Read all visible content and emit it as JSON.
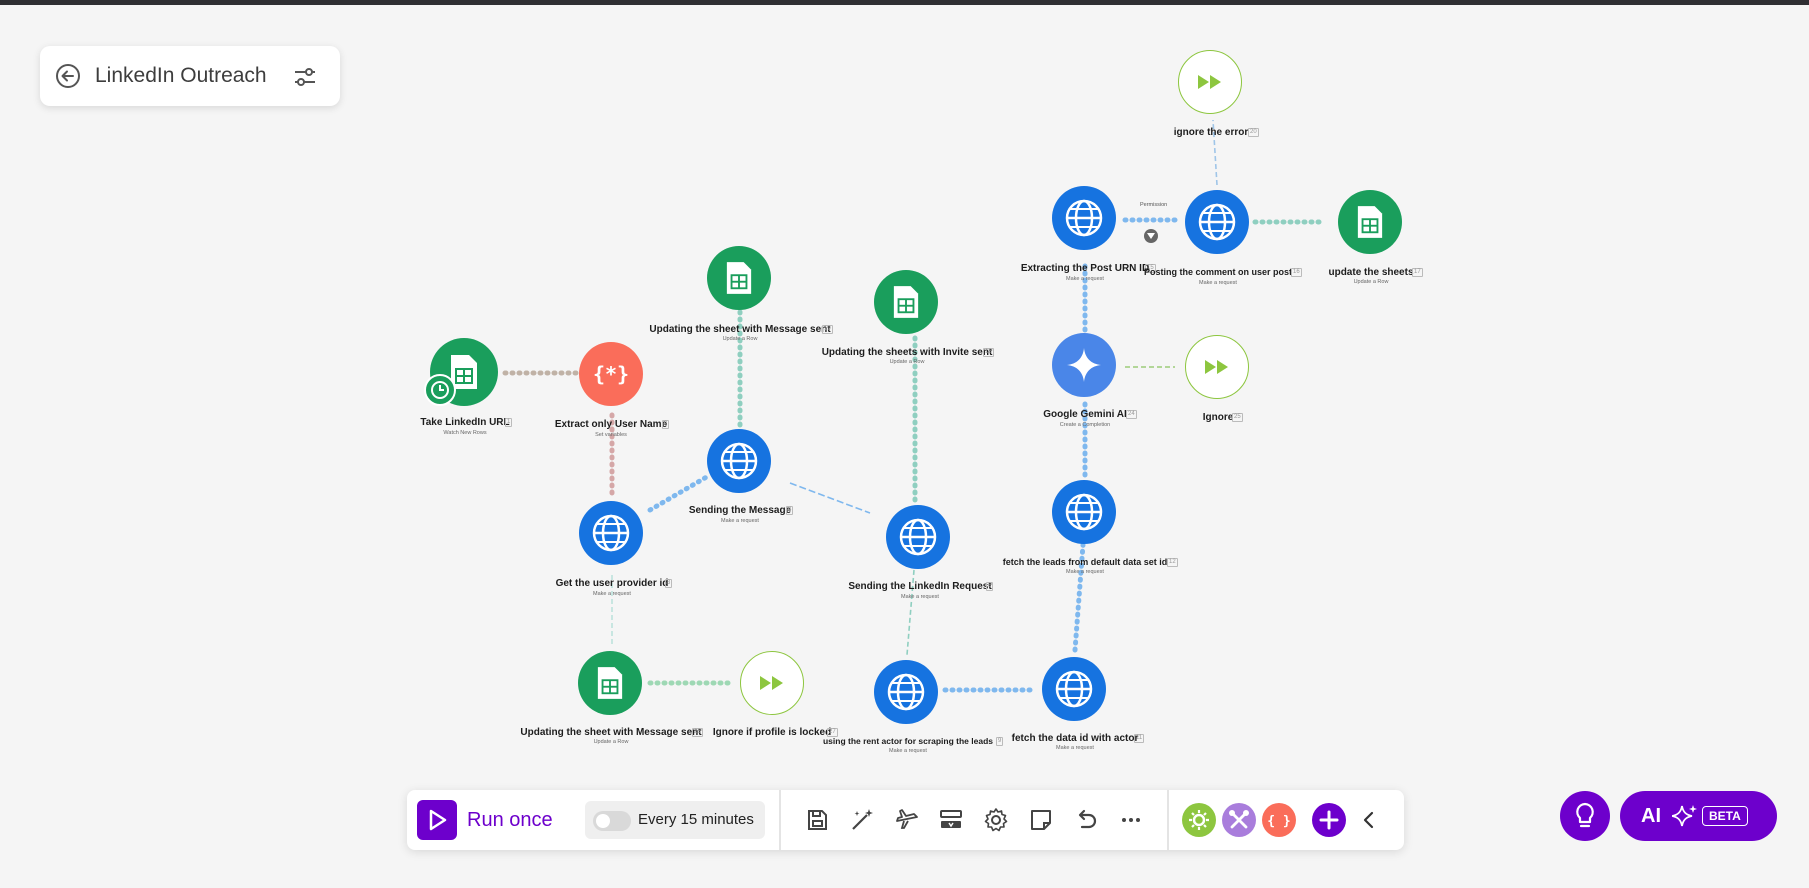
{
  "scenario": {
    "title": "LinkedIn Outreach",
    "back_icon": "arrow-left-circle-icon",
    "settings_icon": "sliders-icon"
  },
  "colors": {
    "sheets": "#1a9e5c",
    "tools": "#fa6d5a",
    "http": "#1673e0",
    "gemini": "#4a86e8",
    "ignore": "#8dc63f",
    "brand": "#6d00cc"
  },
  "modules": [
    {
      "id": "take-linkedin-url",
      "label": "Take LinkedIn URL",
      "sub": "Watch New Rows",
      "num": "1",
      "type": "sheets"
    },
    {
      "id": "extract-user-name",
      "label": "Extract only User Name",
      "sub": "Set variables",
      "num": "2",
      "type": "tools"
    },
    {
      "id": "get-user-provider-id",
      "label": "Get the user provider id",
      "sub": "Make a request",
      "num": "3",
      "type": "http"
    },
    {
      "id": "sending-the-message",
      "label": "Sending the Message",
      "sub": "Make a request",
      "num": "4",
      "type": "http"
    },
    {
      "id": "updating-sheet-message-sent-top",
      "label": "Updating the sheet with Message sent",
      "sub": "Update a Row",
      "num": "19",
      "type": "sheets"
    },
    {
      "id": "updating-sheets-invite-sent",
      "label": "Updating the sheets with Invite sent",
      "sub": "Update a Row",
      "num": "18",
      "type": "sheets"
    },
    {
      "id": "sending-linkedin-request",
      "label": "Sending the LinkedIn Request",
      "sub": "Make a request",
      "num": "6",
      "type": "http"
    },
    {
      "id": "updating-sheet-message-sent-bottom",
      "label": "Updating the sheet with Message sent",
      "sub": "Update a Row",
      "num": "26",
      "type": "sheets"
    },
    {
      "id": "ignore-if-profile-locked",
      "label": "Ignore if profile is locked",
      "sub": "",
      "num": "27",
      "type": "ignore"
    },
    {
      "id": "using-rent-actor",
      "label": "using the rent actor for scraping the leads",
      "sub": "Make a request",
      "num": "9",
      "type": "http"
    },
    {
      "id": "fetch-data-id-actor",
      "label": "fetch the data id with actor",
      "sub": "Make a request",
      "num": "11",
      "type": "http"
    },
    {
      "id": "fetch-leads-default-dataset",
      "label": "fetch the leads from default data set id",
      "sub": "Make a request",
      "num": "12",
      "type": "http"
    },
    {
      "id": "google-gemini-ai",
      "label": "Google Gemini AI",
      "sub": "Create a Completion",
      "num": "24",
      "type": "gemini"
    },
    {
      "id": "ignore",
      "label": "Ignore",
      "sub": "",
      "num": "25",
      "type": "ignore"
    },
    {
      "id": "extracting-post-urn",
      "label": "Extracting the Post URN ID",
      "sub": "Make a request",
      "num": "15",
      "type": "http"
    },
    {
      "id": "posting-comment",
      "label": "Posting the comment on user post",
      "sub": "Make a request",
      "num": "16",
      "type": "http"
    },
    {
      "id": "update-the-sheets",
      "label": "update the sheets",
      "sub": "Update a Row",
      "num": "17",
      "type": "sheets"
    },
    {
      "id": "ignore-the-error",
      "label": "ignore the error",
      "sub": "",
      "num": "20",
      "type": "ignore"
    }
  ],
  "route_labels": {
    "permission": "Permission"
  },
  "toolbar": {
    "run_label": "Run once",
    "schedule_label": "Every 15 minutes",
    "schedule_enabled": false,
    "tools": [
      "save-icon",
      "magic-wand-icon",
      "airplane-icon",
      "explain-flow-icon",
      "gear-icon",
      "notes-icon",
      "undo-icon",
      "more-icon"
    ],
    "quick_modules": [
      "flow-control-icon",
      "tools-icon",
      "json-icon",
      "add-icon",
      "collapse-icon"
    ]
  },
  "assistant": {
    "ai_label": "AI",
    "beta_label": "BETA",
    "hint_icon": "lightbulb-icon"
  }
}
